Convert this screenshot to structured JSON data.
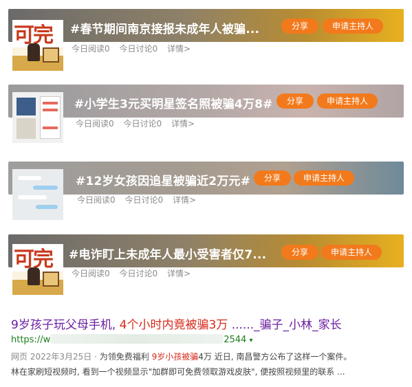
{
  "cards": [
    {
      "title": "#春节期间南京接报未成年人被骗...",
      "share_label": "分享",
      "host_label": "申请主持人",
      "reads": "今日阅读0",
      "discussions": "今日讨论0",
      "details": "详情>",
      "thumb_text": "可完"
    },
    {
      "title": "#小学生3元买明星签名照被骗4万8#",
      "share_label": "分享",
      "host_label": "申请主持人",
      "reads": "今日阅读0",
      "discussions": "今日讨论0",
      "details": "详情>"
    },
    {
      "title": "#12岁女孩因追星被骗近2万元#",
      "share_label": "分享",
      "host_label": "申请主持人",
      "reads": "今日阅读0",
      "discussions": "今日讨论0",
      "details": "详情>"
    },
    {
      "title": "#电诈盯上未成年人最小受害者仅7...",
      "share_label": "分享",
      "host_label": "申请主持人",
      "reads": "今日阅读0",
      "discussions": "今日讨论0",
      "details": "详情>",
      "thumb_text": "可完"
    }
  ],
  "result": {
    "title_part1": "9岁孩子玩父母手机,",
    "title_part2": "4个小时内竟被骗3万",
    "title_part3": "......_骗子_小林_家长",
    "url_prefix": "https://w",
    "url_suffix": "2544",
    "url_caret": "▾",
    "snippet_source": "网页",
    "snippet_date": "2022年3月25日",
    "snippet_sep": "·",
    "snippet_a": "为领免费福利 ",
    "snippet_em": "9岁小孩被骗",
    "snippet_b": "4万 近日, 南昌警方公布了这样一个案件。",
    "snippet_line2": "林在家刷短视频时, 看到一个视频显示\"加群即可免费领取游戏皮肤\", 便按照视频里的联系 ..."
  },
  "colors": {
    "button_orange": "#f27a1c",
    "result_title_purple": "#6a1da0",
    "highlight_red": "#d6291a",
    "url_green": "#1a7d1a"
  }
}
